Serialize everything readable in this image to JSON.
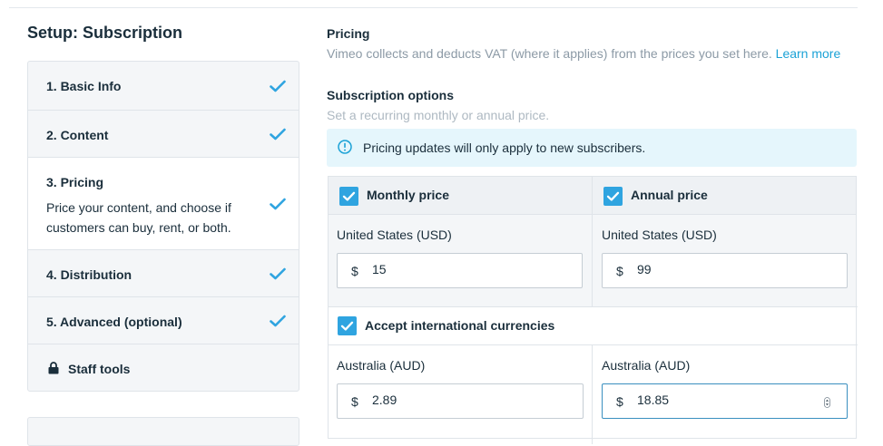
{
  "setup": {
    "title": "Setup: Subscription",
    "steps": [
      {
        "label": "1. Basic Info"
      },
      {
        "label": "2. Content"
      },
      {
        "label": "3. Pricing",
        "description": "Price your content, and choose if customers can buy, rent, or both."
      },
      {
        "label": "4. Distribution"
      },
      {
        "label": "5. Advanced (optional)"
      },
      {
        "label": "Staff tools"
      }
    ]
  },
  "pricing": {
    "title": "Pricing",
    "description": "Vimeo collects and deducts VAT (where it applies) from the prices you set here.",
    "learn_more": "Learn more"
  },
  "subscription": {
    "title": "Subscription options",
    "description": "Set a recurring monthly or annual price.",
    "notice": "Pricing updates will only apply to new subscribers."
  },
  "plans": {
    "monthly": {
      "label": "Monthly price",
      "checked": true,
      "currency": "United States (USD)",
      "symbol": "$",
      "value": "15"
    },
    "annual": {
      "label": "Annual price",
      "checked": true,
      "currency": "United States (USD)",
      "symbol": "$",
      "value": "99"
    }
  },
  "international": {
    "label": "Accept international currencies",
    "checked": true,
    "monthly": {
      "currency": "Australia (AUD)",
      "symbol": "$",
      "value": "2.89"
    },
    "annual": {
      "currency": "Australia (AUD)",
      "symbol": "$",
      "value": "18.85"
    }
  },
  "colors": {
    "accent": "#1ba2d6",
    "checkbox": "#2fa4e0",
    "check_icon": "#2fa4e0"
  }
}
